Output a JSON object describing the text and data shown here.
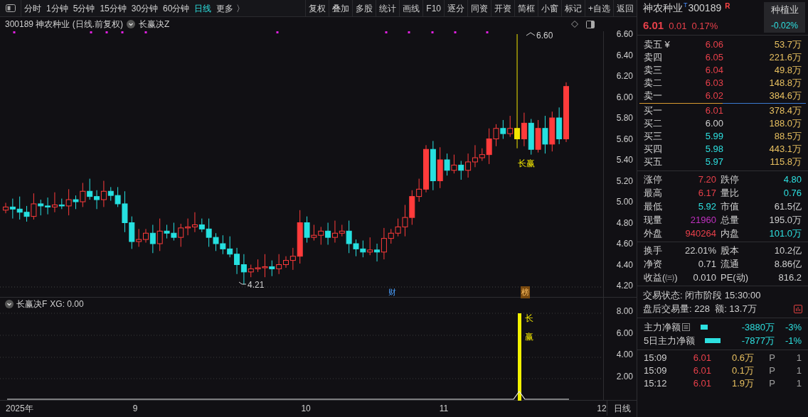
{
  "toolbar": {
    "periods": [
      {
        "label": "分时",
        "selected": false
      },
      {
        "label": "1分钟",
        "selected": false
      },
      {
        "label": "5分钟",
        "selected": false
      },
      {
        "label": "15分钟",
        "selected": false
      },
      {
        "label": "30分钟",
        "selected": false
      },
      {
        "label": "60分钟",
        "selected": false
      },
      {
        "label": "日线",
        "selected": true
      },
      {
        "label": "更多 〉",
        "selected": false
      }
    ],
    "buttons": [
      "复权",
      "叠加",
      "多股",
      "统计",
      "画线",
      "F10",
      "逐分",
      "同资",
      "开资",
      "简框",
      "小窗",
      "标记",
      "+自选",
      "返回"
    ]
  },
  "chart": {
    "title": "300189 神农种业 (日线.前复权)",
    "indicator": "长赢决Z",
    "price_axis": [
      "6.60",
      "6.40",
      "6.20",
      "6.00",
      "5.80",
      "5.60",
      "5.40",
      "5.20",
      "5.00",
      "4.80",
      "4.60",
      "4.40",
      "4.20"
    ],
    "high_label": "6.60",
    "low_label": "4.21",
    "signal_text": "长赢",
    "finance_tag": "财",
    "rank_tag": "榜"
  },
  "sub_chart": {
    "title": "长赢决F",
    "reading": "XG: 0.00",
    "axis": [
      "8.00",
      "6.00",
      "4.00",
      "2.00"
    ],
    "signal_chars": [
      "长",
      "赢"
    ]
  },
  "date_axis": {
    "labels": [
      "2025年",
      "9",
      "10",
      "11",
      "12"
    ],
    "period": "日线"
  },
  "quote": {
    "name": "神农种业",
    "badge": "T",
    "code": "300189",
    "flag": "R",
    "price": "6.01",
    "change": "0.01",
    "percent": "0.17%",
    "sector": "种植业",
    "sector_percent": "-0.02%"
  },
  "order_book": {
    "sell": [
      {
        "label": "卖五 ¥",
        "price": "6.06",
        "volume": "53.7万",
        "color": "#e8404a"
      },
      {
        "label": "卖四",
        "price": "6.05",
        "volume": "221.6万",
        "color": "#e8404a"
      },
      {
        "label": "卖三",
        "price": "6.04",
        "volume": "49.8万",
        "color": "#e8404a"
      },
      {
        "label": "卖二",
        "price": "6.03",
        "volume": "148.8万",
        "color": "#e8404a"
      },
      {
        "label": "卖一",
        "price": "6.02",
        "volume": "384.6万",
        "color": "#e8404a"
      }
    ],
    "buy": [
      {
        "label": "买一",
        "price": "6.01",
        "volume": "378.4万",
        "color": "#e8404a"
      },
      {
        "label": "买二",
        "price": "6.00",
        "volume": "188.0万",
        "color": "#d0d0d0"
      },
      {
        "label": "买三",
        "price": "5.99",
        "volume": "88.5万",
        "color": "#2de0e0"
      },
      {
        "label": "买四",
        "price": "5.98",
        "volume": "443.1万",
        "color": "#2de0e0"
      },
      {
        "label": "买五",
        "price": "5.97",
        "volume": "115.8万",
        "color": "#2de0e0"
      }
    ]
  },
  "stats": [
    [
      {
        "label": "涨停",
        "value": "7.20",
        "color": "#e8404a"
      },
      {
        "label": "跌停",
        "value": "4.80",
        "color": "#2de0e0"
      }
    ],
    [
      {
        "label": "最高",
        "value": "6.17",
        "color": "#e8404a"
      },
      {
        "label": "量比",
        "value": "0.76",
        "color": "#2de0e0"
      }
    ],
    [
      {
        "label": "最低",
        "value": "5.92",
        "color": "#2de0e0"
      },
      {
        "label": "市值",
        "value": "61.5亿",
        "color": "#d0d0d0"
      }
    ],
    [
      {
        "label": "现量",
        "value": "21960",
        "color": "#c030c0"
      },
      {
        "label": "总量",
        "value": "195.0万",
        "color": "#d0d0d0"
      }
    ],
    [
      {
        "label": "外盘",
        "value": "940264",
        "color": "#e8404a"
      },
      {
        "label": "内盘",
        "value": "101.0万",
        "color": "#2de0e0"
      }
    ]
  ],
  "fundamentals": [
    [
      {
        "label": "换手",
        "value": "22.01%"
      },
      {
        "label": "股本",
        "value": "10.2亿"
      }
    ],
    [
      {
        "label": "净资",
        "value": "0.71"
      },
      {
        "label": "流通",
        "value": "8.86亿"
      }
    ],
    [
      {
        "label": "收益(㈢)",
        "value": "0.010"
      },
      {
        "label": "PE(动)",
        "value": "816.2"
      }
    ]
  ],
  "status": {
    "state": "交易状态: 闭市阶段 15:30:00",
    "after_hours": "盘后交易量: 228  额: 13.7万"
  },
  "flows": [
    {
      "label": "主力净额",
      "has_icon": true,
      "amount": "-3880万",
      "percent": "-3%"
    },
    {
      "label": "5日主力净额",
      "has_icon": false,
      "amount": "-7877万",
      "percent": "-1%"
    }
  ],
  "trades": [
    {
      "time": "15:09",
      "price": "6.01",
      "volume": "0.6万",
      "flag": "P",
      "count": "1"
    },
    {
      "time": "15:09",
      "price": "6.01",
      "volume": "0.1万",
      "flag": "P",
      "count": "1"
    },
    {
      "time": "15:12",
      "price": "6.01",
      "volume": "1.9万",
      "flag": "P",
      "count": "1"
    }
  ]
}
